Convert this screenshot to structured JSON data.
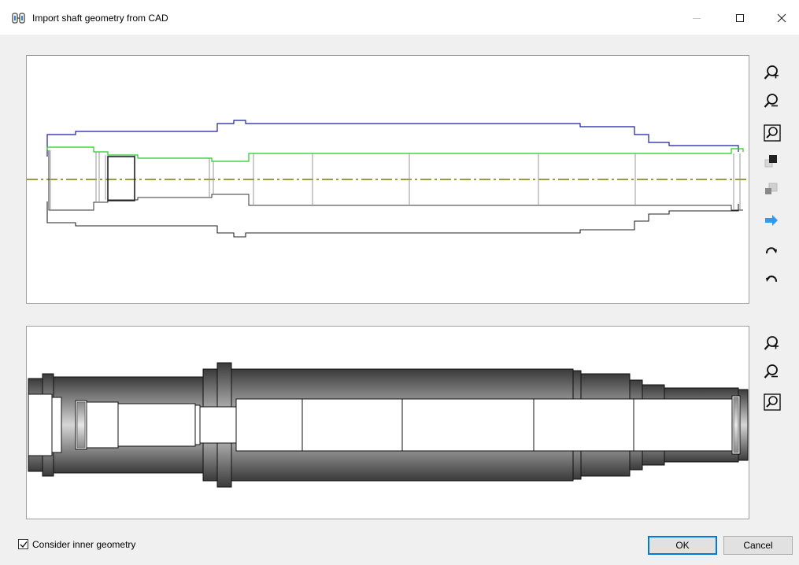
{
  "window": {
    "title": "Import shaft geometry from CAD",
    "app_icon": "shaft-app-icon",
    "controls": [
      "minimize-icon",
      "maximize-icon",
      "close-icon"
    ]
  },
  "top_toolbar": [
    {
      "name": "zoom-in-icon"
    },
    {
      "name": "zoom-out-icon"
    },
    {
      "name": "zoom-fit-icon"
    },
    {
      "name": "bring-forward-icon"
    },
    {
      "name": "send-backward-icon"
    },
    {
      "name": "arrow-right-icon"
    },
    {
      "name": "rotate-clockwise-icon"
    },
    {
      "name": "rotate-counterclockwise-icon"
    }
  ],
  "bottom_toolbar": [
    {
      "name": "zoom-in-icon"
    },
    {
      "name": "zoom-out-icon"
    },
    {
      "name": "zoom-fit-icon"
    }
  ],
  "colors": {
    "outer_contour": "#1a1aa8",
    "inner_contour": "#22cc22",
    "axis": "#7a7a00",
    "accent": "#0078d7",
    "arrow": "#3399ee"
  },
  "options": {
    "consider_inner_geometry": {
      "label": "Consider inner geometry",
      "checked": true
    }
  },
  "buttons": {
    "ok_label": "OK",
    "cancel_label": "Cancel"
  }
}
